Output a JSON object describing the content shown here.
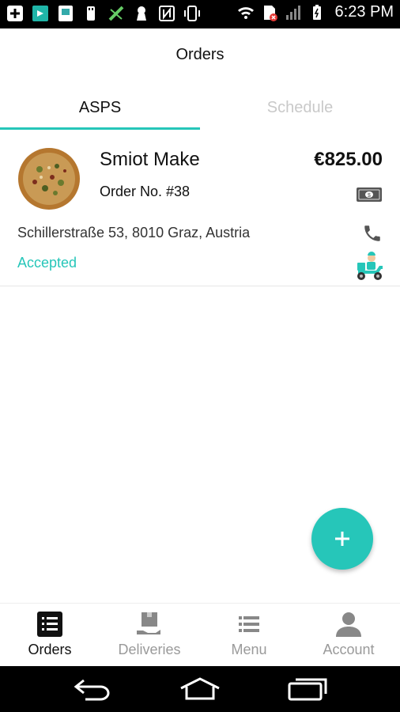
{
  "status_bar": {
    "time": "6:23 PM",
    "icons": [
      "plus-box-icon",
      "app-icon",
      "app-icon",
      "usb-icon",
      "no-signal-icon",
      "keyhole-icon",
      "nfc-icon",
      "vibrate-icon",
      "wifi-icon",
      "sim-error-icon",
      "signal-icon",
      "battery-icon"
    ]
  },
  "header": {
    "title": "Orders"
  },
  "tabs": [
    {
      "label": "ASPS",
      "active": true
    },
    {
      "label": "Schedule",
      "active": false
    }
  ],
  "order": {
    "restaurant": "Smiot Make",
    "price": "€825.00",
    "order_number": "Order No. #38",
    "address": "Schillerstraße 53, 8010 Graz, Austria",
    "status": "Accepted",
    "payment_icon": "cash-icon",
    "phone_icon": "phone-icon",
    "delivery_icon": "scooter-icon"
  },
  "fab": {
    "icon": "plus-icon"
  },
  "bottom_nav": [
    {
      "label": "Orders",
      "icon": "list-icon",
      "active": true
    },
    {
      "label": "Deliveries",
      "icon": "box-icon",
      "active": false
    },
    {
      "label": "Menu",
      "icon": "menu-icon",
      "active": false
    },
    {
      "label": "Account",
      "icon": "person-icon",
      "active": false
    }
  ],
  "colors": {
    "accent": "#26c6b9",
    "inactive": "#9a9a9a"
  }
}
